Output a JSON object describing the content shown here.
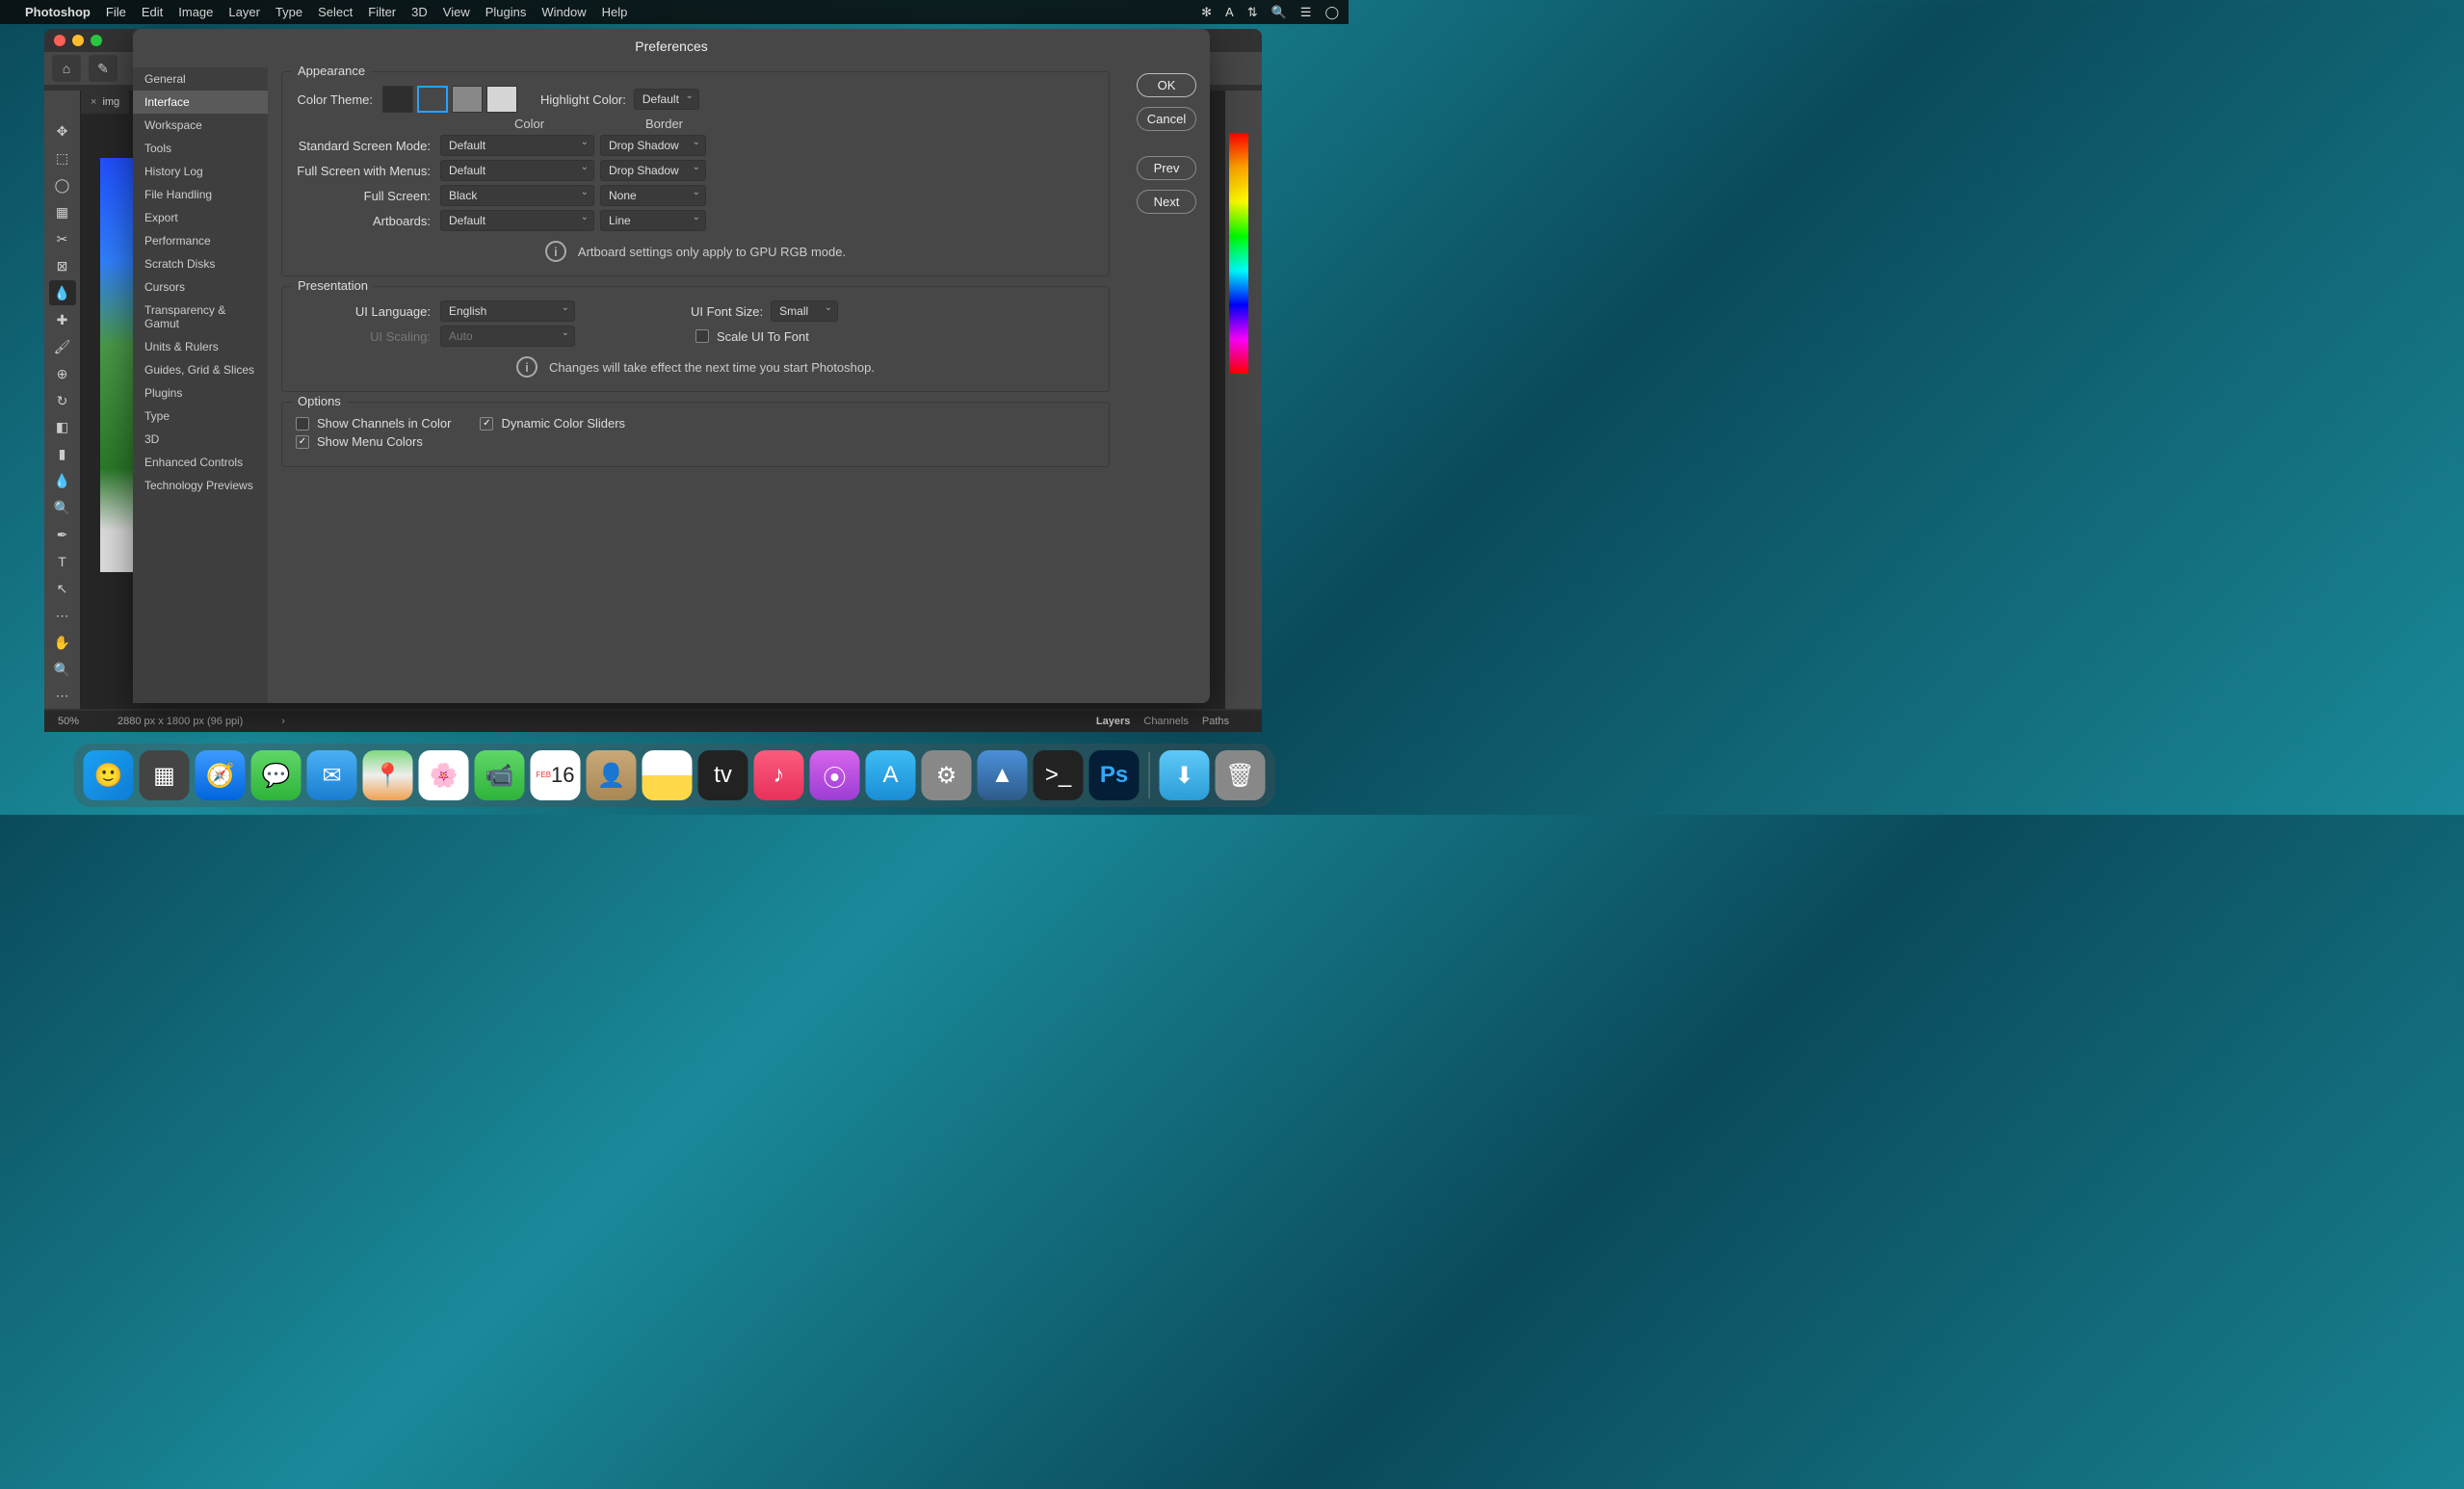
{
  "menubar": {
    "app": "Photoshop",
    "items": [
      "File",
      "Edit",
      "Image",
      "Layer",
      "Type",
      "Select",
      "Filter",
      "3D",
      "View",
      "Plugins",
      "Window",
      "Help"
    ]
  },
  "ps": {
    "tab": "img",
    "zoom": "50%",
    "docinfo": "2880 px x 1800 px (96 ppi)",
    "panel_tabs": [
      "Layers",
      "Channels",
      "Paths"
    ]
  },
  "prefs": {
    "title": "Preferences",
    "buttons": {
      "ok": "OK",
      "cancel": "Cancel",
      "prev": "Prev",
      "next": "Next"
    },
    "categories": [
      "General",
      "Interface",
      "Workspace",
      "Tools",
      "History Log",
      "File Handling",
      "Export",
      "Performance",
      "Scratch Disks",
      "Cursors",
      "Transparency & Gamut",
      "Units & Rulers",
      "Guides, Grid & Slices",
      "Plugins",
      "Type",
      "3D",
      "Enhanced Controls",
      "Technology Previews"
    ],
    "selected": "Interface",
    "appearance": {
      "title": "Appearance",
      "color_theme_label": "Color Theme:",
      "highlight_label": "Highlight Color:",
      "highlight_value": "Default",
      "headers": {
        "color": "Color",
        "border": "Border"
      },
      "rows": [
        {
          "label": "Standard Screen Mode:",
          "color": "Default",
          "border": "Drop Shadow"
        },
        {
          "label": "Full Screen with Menus:",
          "color": "Default",
          "border": "Drop Shadow"
        },
        {
          "label": "Full Screen:",
          "color": "Black",
          "border": "None"
        },
        {
          "label": "Artboards:",
          "color": "Default",
          "border": "Line"
        }
      ],
      "note": "Artboard settings only apply to GPU RGB mode."
    },
    "presentation": {
      "title": "Presentation",
      "lang_label": "UI Language:",
      "lang_value": "English",
      "font_label": "UI Font Size:",
      "font_value": "Small",
      "scale_label": "UI Scaling:",
      "scale_value": "Auto",
      "scale_cb": "Scale UI To Font",
      "note": "Changes will take effect the next time you start Photoshop."
    },
    "options": {
      "title": "Options",
      "cb1": "Show Channels in Color",
      "cb2": "Dynamic Color Sliders",
      "cb3": "Show Menu Colors"
    }
  },
  "dock": {
    "cal_month": "FEB",
    "cal_day": "16"
  }
}
